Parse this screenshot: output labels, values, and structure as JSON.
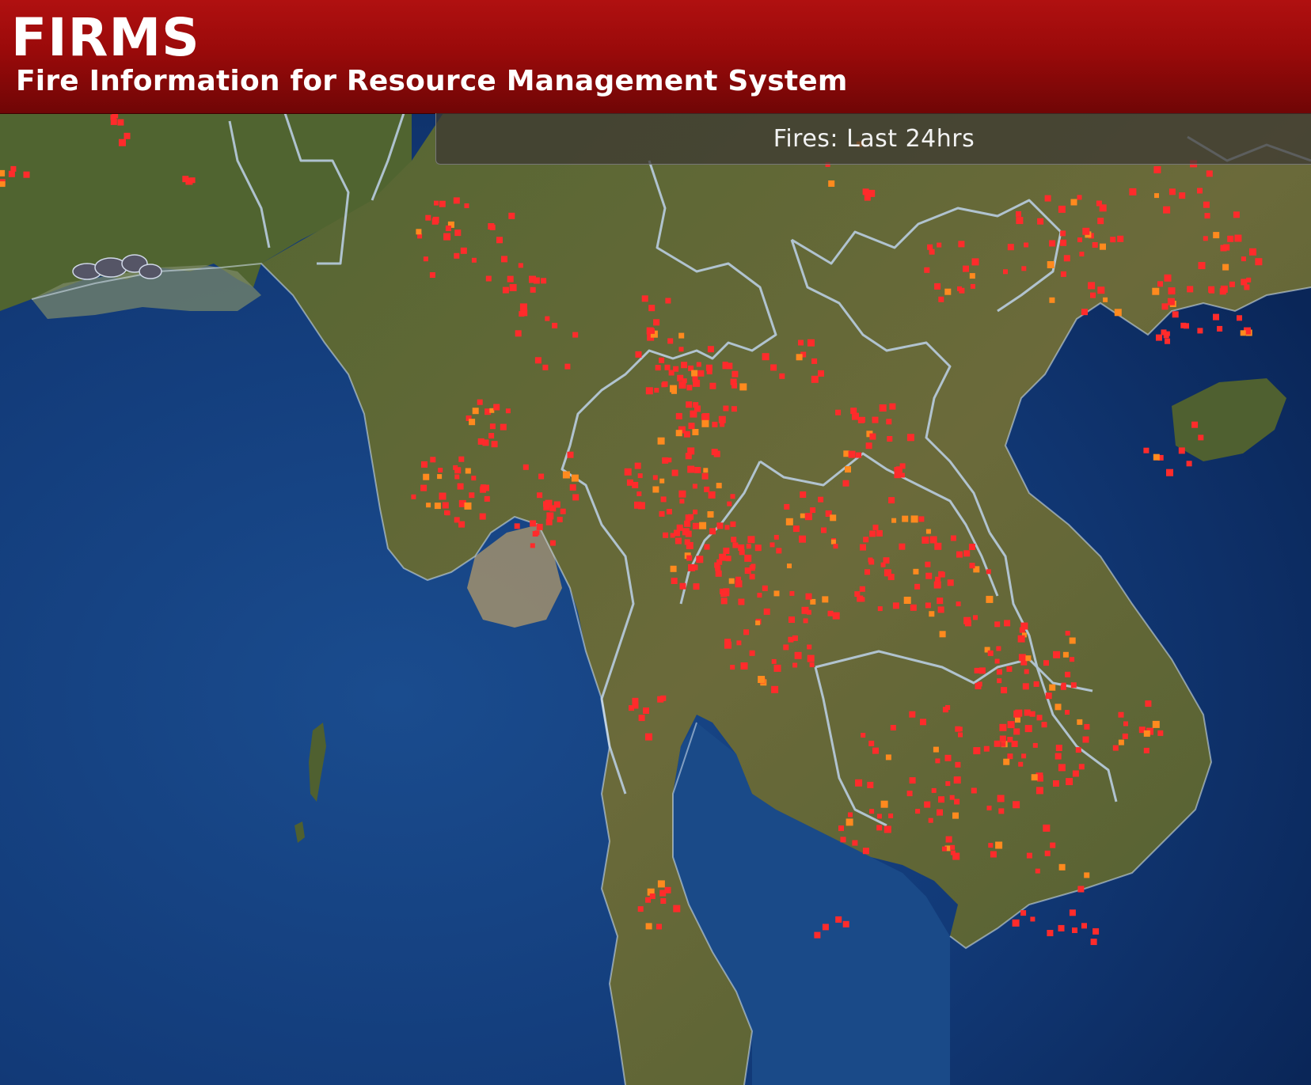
{
  "header": {
    "title": "FIRMS",
    "subtitle": "Fire Information for Resource Management System"
  },
  "time_filter": {
    "label": "Fires: Last 24hrs"
  },
  "colors": {
    "header_red": "#a00c0c",
    "fire_red": "#ff2b2b",
    "fire_orange": "#ff8a1e",
    "ocean": "#123a78",
    "land": "#5c6a34",
    "border": "#b9cde0"
  },
  "icons": {
    "fire_marker": "fire-hotspot-icon"
  }
}
